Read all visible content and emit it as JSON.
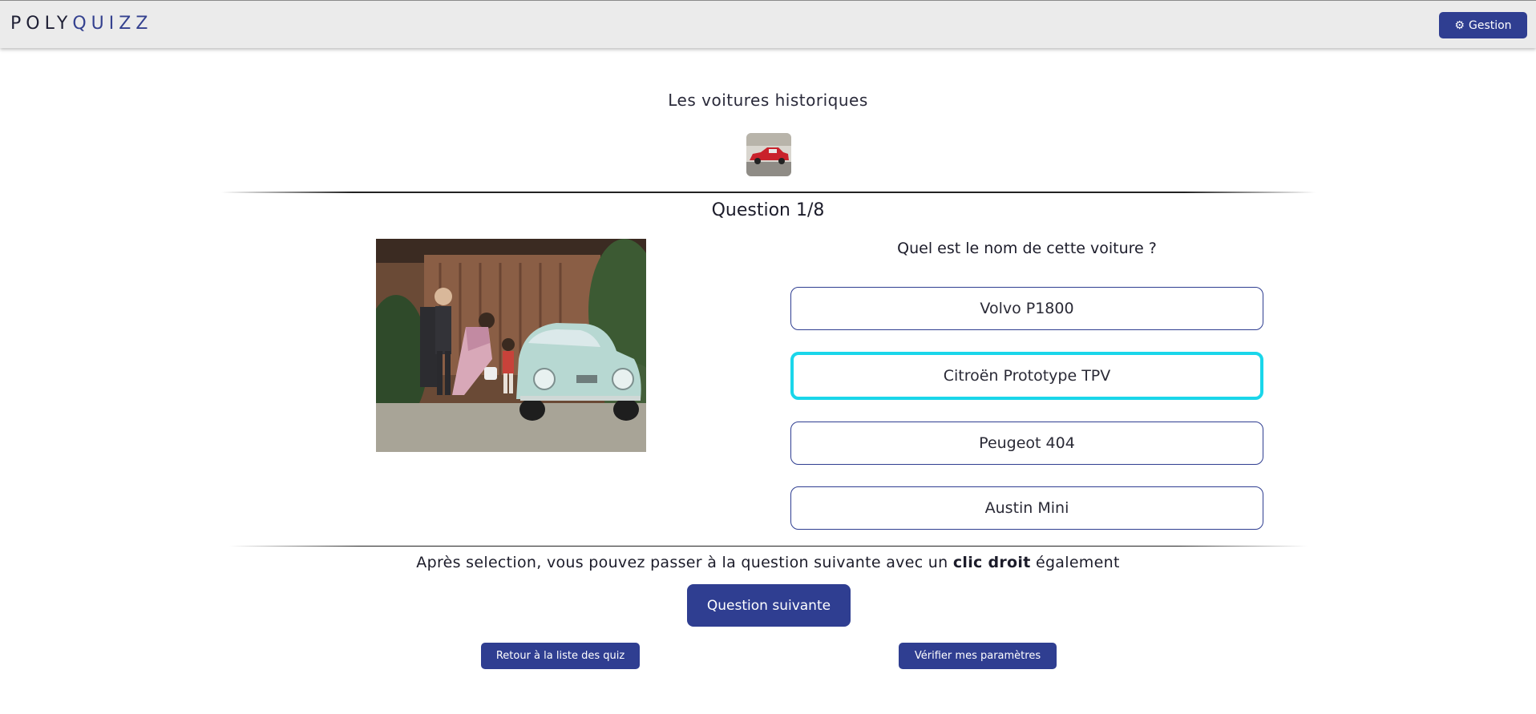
{
  "header": {
    "logo_part1": "POLY",
    "logo_part2": "QUIZZ",
    "gestion_label": "Gestion",
    "gestion_icon": "gear-icon"
  },
  "quiz": {
    "title": "Les voitures historiques",
    "thumbnail_alt": "red vintage car"
  },
  "question": {
    "number_label": "Question 1/8",
    "text": "Quel est le nom de cette voiture ?",
    "answers": [
      {
        "label": "Volvo P1800",
        "selected": false
      },
      {
        "label": "Citroën Prototype TPV",
        "selected": true
      },
      {
        "label": "Peugeot 404",
        "selected": false
      },
      {
        "label": "Austin Mini",
        "selected": false
      }
    ]
  },
  "footer": {
    "hint_part1": "Après selection, vous pouvez passer à la question suivante avec un ",
    "hint_bold": "clic droit",
    "hint_part2": " également",
    "next_label": "Question suivante",
    "back_label": "Retour à la liste des quiz",
    "verify_label": "Vérifier mes paramètres"
  },
  "colors": {
    "primary": "#2f3e91",
    "selected_border": "#1ad6ea",
    "header_bg": "#ebebeb"
  }
}
